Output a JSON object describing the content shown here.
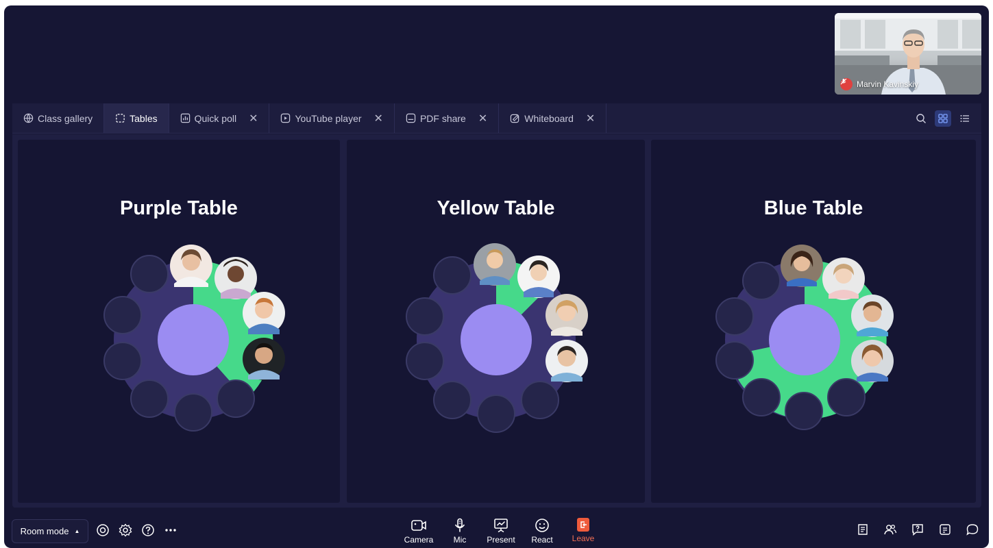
{
  "presenter": {
    "name": "Marvin Kavinskiy",
    "muted": true
  },
  "tabs": [
    {
      "label": "Class gallery",
      "icon": "globe-icon",
      "closable": false,
      "active": false
    },
    {
      "label": "Tables",
      "icon": "tables-icon",
      "closable": false,
      "active": true
    },
    {
      "label": "Quick poll",
      "icon": "poll-icon",
      "closable": true,
      "active": false
    },
    {
      "label": "YouTube player",
      "icon": "play-icon",
      "closable": true,
      "active": false
    },
    {
      "label": "PDF share",
      "icon": "pdf-icon",
      "closable": true,
      "active": false
    },
    {
      "label": "Whiteboard",
      "icon": "whiteboard-icon",
      "closable": true,
      "active": false
    }
  ],
  "view_toggle": {
    "selected": "grid"
  },
  "tables": [
    {
      "title": "Purple Table",
      "occupied_seats": 4,
      "total_seats": 10
    },
    {
      "title": "Yellow Table",
      "occupied_seats": 4,
      "total_seats": 10
    },
    {
      "title": "Blue Table",
      "occupied_seats": 4,
      "total_seats": 10
    }
  ],
  "bottom": {
    "room_mode": "Room mode",
    "controls": {
      "camera": "Camera",
      "mic": "Mic",
      "present": "Present",
      "react": "React",
      "leave": "Leave"
    }
  },
  "colors": {
    "background": "#161634",
    "table_center": "#9b8cf2",
    "table_ring": "#3a3470",
    "occupied_arc": "#46d98a",
    "leave": "#ef5b3c"
  }
}
